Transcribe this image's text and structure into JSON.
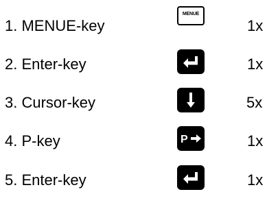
{
  "steps": [
    {
      "label": "1. MENUE-key",
      "key_icon": "menue-key-icon",
      "key_text": "MENUE",
      "count": "1x"
    },
    {
      "label": "2. Enter-key",
      "key_icon": "enter-key-icon",
      "count": "1x"
    },
    {
      "label": "3. Cursor-key",
      "key_icon": "cursor-down-key-icon",
      "count": "5x"
    },
    {
      "label": "4. P-key",
      "key_icon": "p-key-icon",
      "key_text": "P",
      "count": "1x"
    },
    {
      "label": "5. Enter-key",
      "key_icon": "enter-key-icon",
      "count": "1x"
    }
  ]
}
